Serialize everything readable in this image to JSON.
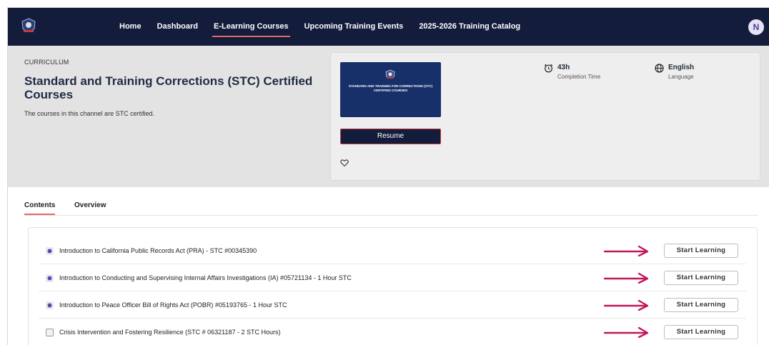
{
  "nav": {
    "items": [
      {
        "label": "Home",
        "active": false
      },
      {
        "label": "Dashboard",
        "active": false
      },
      {
        "label": "E-Learning Courses",
        "active": true
      },
      {
        "label": "Upcoming Training Events",
        "active": false
      },
      {
        "label": "2025-2026 Training Catalog",
        "active": false
      }
    ],
    "avatar_initial": "N",
    "logo_icon": "agency-badge-icon"
  },
  "hero": {
    "eyebrow": "CURRICULUM",
    "title": "Standard and Training Corrections (STC) Certified Courses",
    "description": "The courses in this channel are STC certified.",
    "thumbnail_text": "STANDARD AND TRAINING FOR CORRECTIONS (STC) CERTIFIED COURSES",
    "resume_label": "Resume",
    "completion": {
      "value": "43h",
      "label": "Completion Time",
      "icon": "alarm-clock-icon"
    },
    "language": {
      "value": "English",
      "label": "Language",
      "icon": "globe-icon"
    },
    "favorite_icon": "heart-icon"
  },
  "tabs": [
    {
      "label": "Contents",
      "active": true
    },
    {
      "label": "Overview",
      "active": false
    }
  ],
  "contents": [
    {
      "title": "Introduction to California Public Records Act (PRA) - STC #00345390",
      "button": "Start Learning",
      "icon": "course-icon"
    },
    {
      "title": "Introduction to Conducting and Supervising Internal Affairs Investigations (IA) #05721134 - 1 Hour STC",
      "button": "Start Learning",
      "icon": "course-icon"
    },
    {
      "title": "Introduction to Peace Officer Bill of Rights Act (POBR) #05193765 - 1 Hour STC",
      "button": "Start Learning",
      "icon": "course-icon"
    },
    {
      "title": "Crisis Intervention and Fostering Resilience (STC # 06321187 - 2 STC Hours)",
      "button": "Start Learning",
      "icon": "checkbox-icon"
    }
  ],
  "colors": {
    "nav_bg": "#141c3b",
    "accent": "#e06a6a",
    "hero_bg": "#e3e3e3",
    "thumbnail_bg": "#17306a",
    "annotation_arrow": "#c2185b"
  }
}
